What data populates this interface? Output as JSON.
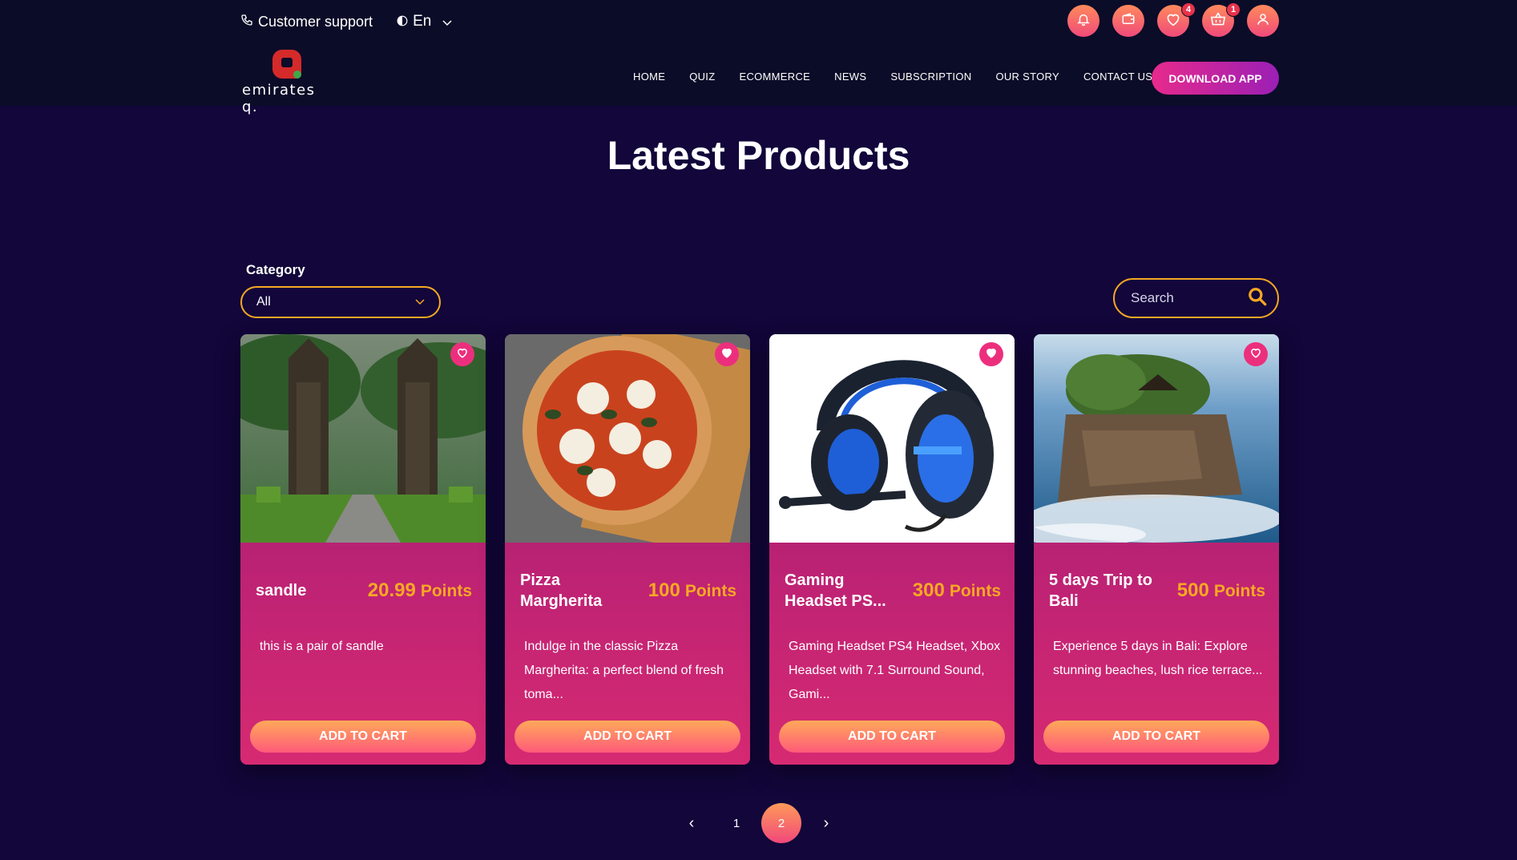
{
  "topbar": {
    "support_label": "Customer support",
    "language": "En",
    "wishlist_count": "4",
    "cart_count": "1"
  },
  "logo": {
    "text": "emirates q."
  },
  "nav": {
    "items": [
      "HOME",
      "QUIZ",
      "ECOMMERCE",
      "NEWS",
      "SUBSCRIPTION",
      "OUR STORY",
      "CONTACT US"
    ],
    "download_label": "DOWNLOAD APP"
  },
  "page": {
    "title": "Latest Products"
  },
  "filters": {
    "category_label": "Category",
    "category_value": "All",
    "search_placeholder": "Search"
  },
  "products": [
    {
      "title": "sandle",
      "points_value": "20.99",
      "points_label": "Points",
      "description": "this is a pair of sandle",
      "cart_label": "ADD TO CART",
      "image": "bali-gate-photo"
    },
    {
      "title": "Pizza Margherita",
      "points_value": "100",
      "points_label": "Points",
      "description": "Indulge in the classic Pizza Margherita: a perfect blend of fresh toma...",
      "cart_label": "ADD TO CART",
      "image": "pizza-photo"
    },
    {
      "title": "Gaming Headset PS...",
      "points_value": "300",
      "points_label": "Points",
      "description": "Gaming Headset PS4 Headset, Xbox Headset with 7.1 Surround Sound, Gami...",
      "cart_label": "ADD TO CART",
      "image": "headset-photo"
    },
    {
      "title": "5 days Trip to Bali",
      "points_value": "500",
      "points_label": "Points",
      "description": "Experience 5 days in Bali: Explore stunning beaches, lush rice terrace...",
      "cart_label": "ADD TO CART",
      "image": "bali-temple-photo"
    }
  ],
  "pagination": {
    "prev": "‹",
    "pages": [
      "1",
      "2"
    ],
    "current": "2",
    "next": "›"
  },
  "colors": {
    "background": "#12063a",
    "header": "#0b0c28",
    "accent": "#f7a823",
    "pink": "#ec2f7d"
  }
}
